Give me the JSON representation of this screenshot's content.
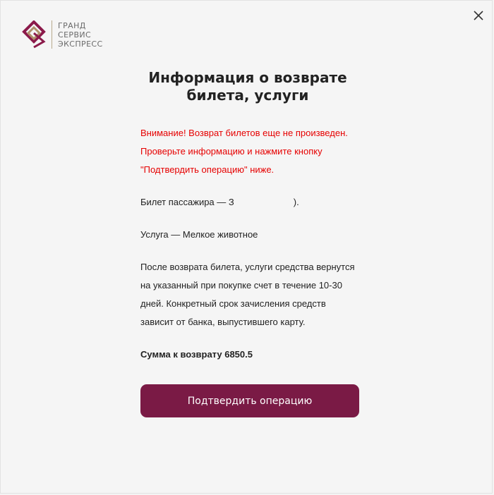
{
  "logo": {
    "line1": "ГРАНД",
    "line2": "СЕРВИС",
    "line3": "ЭКСПРЕСС",
    "icon": "brand-logo-icon"
  },
  "close": {
    "icon": "close-icon"
  },
  "title": {
    "line1": "Информация о возврате",
    "line2": "билета, услуги"
  },
  "warning": {
    "line1": "Внимание! Возврат билетов еще не произведен.",
    "line2": "Проверьте информацию и нажмите кнопку",
    "line3": "\"Подтвердить операцию\" ниже."
  },
  "ticket": {
    "label": "Билет пассажира — З",
    "suffix": ")."
  },
  "service": {
    "text": "Услуга — Мелкое животное"
  },
  "refund_info": {
    "text": "После возврата билета, услуги средства вернутся на указанный при покупке счет в течение 10-30 дней. Конкретный срок зачисления средств зависит от банка, выпустившего карту."
  },
  "sum": {
    "text": "Сумма к возврату 6850.5"
  },
  "confirm_button": {
    "label": "Подтвердить операцию"
  },
  "colors": {
    "accent": "#7a1a45",
    "warning": "#e60000",
    "background": "#f5f5f5"
  }
}
